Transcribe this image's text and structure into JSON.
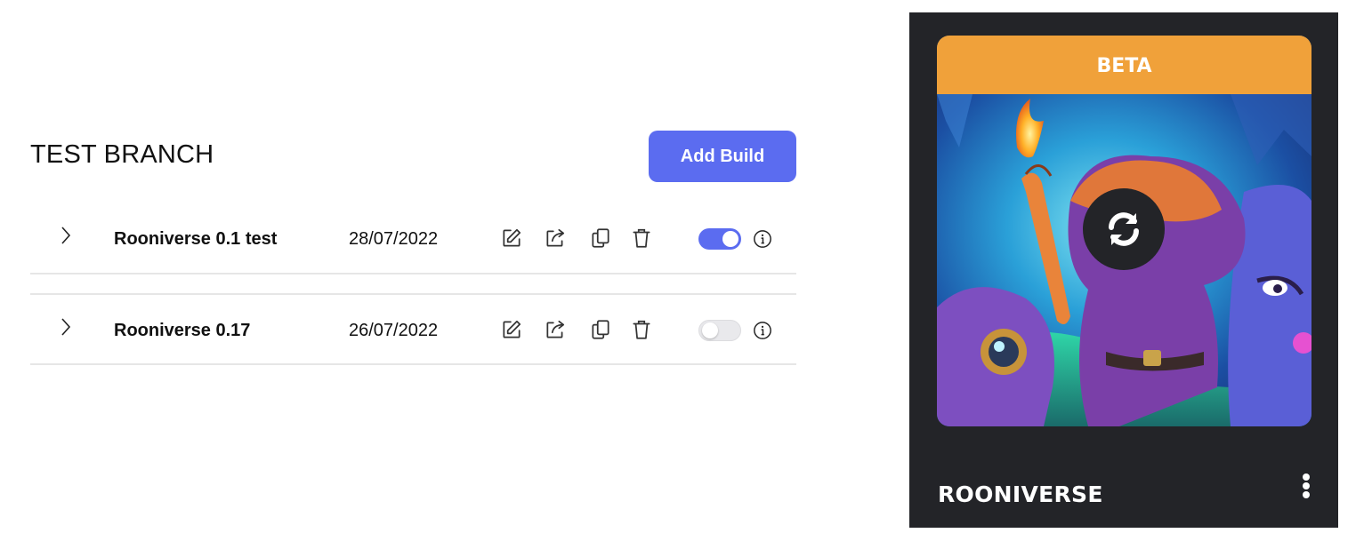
{
  "branch": {
    "title": "TEST BRANCH",
    "add_build_label": "Add Build"
  },
  "builds": [
    {
      "name": "Rooniverse 0.1 test",
      "date": "28/07/2022",
      "enabled": true
    },
    {
      "name": "Rooniverse 0.17",
      "date": "26/07/2022",
      "enabled": false
    }
  ],
  "row_icons": [
    "chevron-right-icon",
    "edit-icon",
    "share-icon",
    "copy-icon",
    "trash-icon",
    "info-icon"
  ],
  "game_card": {
    "badge": "BETA",
    "name": "ROONIVERSE",
    "icons": [
      "refresh-icon",
      "more-vertical-icon"
    ]
  },
  "colors": {
    "accent": "#5b6cf0",
    "beta": "#f0a13a",
    "card_bg": "#232428"
  }
}
